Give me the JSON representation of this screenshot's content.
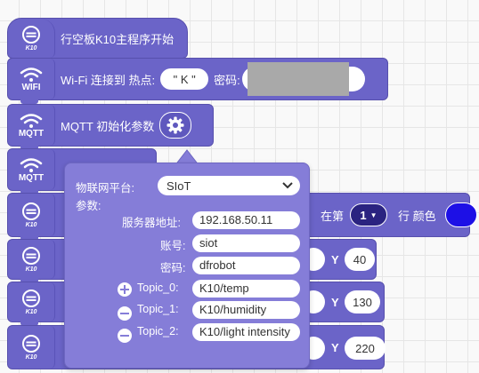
{
  "blocks": {
    "main_start": {
      "label": "行空板K10主程序开始",
      "badge": "K10"
    },
    "wifi": {
      "badge": "WIFI",
      "label": "Wi-Fi 连接到 热点:",
      "ssid_value": "\" K \"",
      "password_label": "密码:"
    },
    "mqtt_init": {
      "badge": "MQTT",
      "label": "MQTT 初始化参数"
    },
    "mqtt_connect": {
      "badge": "MQTT"
    },
    "row_block": {
      "badge": "K10",
      "row_prefix": "在第",
      "row_value": "1",
      "row_suffix": "行 颜色",
      "color": "#1d10e6"
    },
    "coord1": {
      "badge": "K10",
      "y_label": "Y",
      "y_value": "40"
    },
    "coord2": {
      "badge": "K10",
      "y_label": "Y",
      "y_value": "130"
    },
    "coord3": {
      "badge": "K10",
      "y_label": "Y",
      "y_value": "220"
    }
  },
  "popup": {
    "platform_label": "物联网平台:",
    "platform_value": "SIoT",
    "params_label": "参数:",
    "server_label": "服务器地址:",
    "server_value": "192.168.50.11",
    "account_label": "账号:",
    "account_value": "siot",
    "password_label": "密码:",
    "password_value": "dfrobot",
    "topic0_label": "Topic_0:",
    "topic0_value": "K10/temp",
    "topic1_label": "Topic_1:",
    "topic1_value": "K10/humidity",
    "topic2_label": "Topic_2:",
    "topic2_value": "K10/light intensity"
  },
  "colors": {
    "block": "#6b64c8",
    "popup": "#857dd8",
    "dark_pill": "#2a2380"
  }
}
